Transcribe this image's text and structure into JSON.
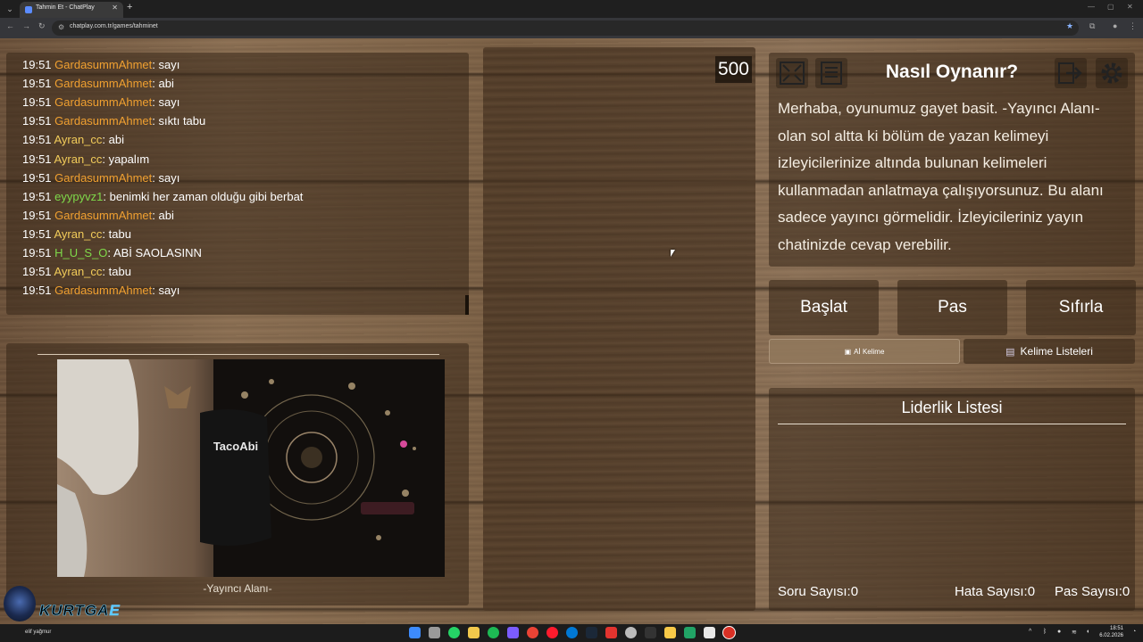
{
  "browser": {
    "tab_title": "Tahmin Et - ChatPlay",
    "url": "chatplay.com.tr/games/tahminet"
  },
  "chat": {
    "messages": [
      {
        "time": "19:51",
        "user": "GardasummAhmet",
        "color": "#f0a030",
        "text": "sayı"
      },
      {
        "time": "19:51",
        "user": "GardasummAhmet",
        "color": "#f0a030",
        "text": "abi"
      },
      {
        "time": "19:51",
        "user": "GardasummAhmet",
        "color": "#f0a030",
        "text": "sayı"
      },
      {
        "time": "19:51",
        "user": "GardasummAhmet",
        "color": "#f0a030",
        "text": "sıktı tabu"
      },
      {
        "time": "19:51",
        "user": "Ayran_cc",
        "color": "#f2cc5a",
        "text": "abi"
      },
      {
        "time": "19:51",
        "user": "Ayran_cc",
        "color": "#f2cc5a",
        "text": "yapalım"
      },
      {
        "time": "19:51",
        "user": "GardasummAhmet",
        "color": "#f0a030",
        "text": "sayı"
      },
      {
        "time": "19:51",
        "user": "eyypyvz1",
        "color": "#7fd94a",
        "text": "benimki her zaman olduğu gibi berbat"
      },
      {
        "time": "19:51",
        "user": "GardasummAhmet",
        "color": "#f0a030",
        "text": "abi"
      },
      {
        "time": "19:51",
        "user": "Ayran_cc",
        "color": "#f2cc5a",
        "text": "tabu"
      },
      {
        "time": "19:51",
        "user": "H_U_S_O",
        "color": "#7fd94a",
        "text": "ABİ SAOLASINN"
      },
      {
        "time": "19:51",
        "user": "Ayran_cc",
        "color": "#f2cc5a",
        "text": "tabu"
      },
      {
        "time": "19:51",
        "user": "GardasummAhmet",
        "color": "#f0a030",
        "text": "sayı"
      }
    ]
  },
  "camera": {
    "overlay_text": "TacoAbi",
    "caption": "-Yayıncı Alanı-"
  },
  "game": {
    "score": "500"
  },
  "howto": {
    "title": "Nasıl Oynanır?",
    "body": "Merhaba, oyunumuz gayet basit. -Yayıncı Alanı- olan sol altta ki bölüm de yazan kelimeyi izleyicilerinize altında bulunan kelimeleri kullanmadan anlatmaya çalışıyorsunuz. Bu alanı sadece yayıncı görmelidir. İzleyicileriniz yayın chatinizde cevap verebilir.",
    "icons": [
      "fullscreen-icon",
      "notes-icon",
      "logout-icon",
      "gear-icon"
    ]
  },
  "buttons": {
    "start": "Başlat",
    "pass": "Pas",
    "reset": "Sıfırla",
    "ai_word": "Aİ Kelime",
    "word_lists": "Kelime Listeleri"
  },
  "leaderboard": {
    "title": "Liderlik Listesi",
    "question_count": "Soru Sayısı:0",
    "error_count": "Hata Sayısı:0",
    "pass_count": "Pas Sayısı:0"
  },
  "watermark": {
    "brand_a": "KURTGA",
    "brand_b": "E",
    "song": "elif yağmur"
  },
  "taskbar": {
    "time": "18:51",
    "date": "6.02.2026"
  }
}
